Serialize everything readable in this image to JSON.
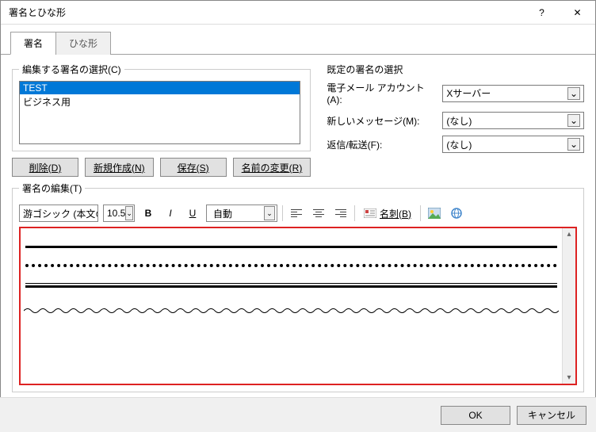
{
  "window": {
    "title": "署名とひな形",
    "help": "?",
    "close": "✕"
  },
  "tabs": {
    "signature": "署名",
    "template": "ひな形"
  },
  "left": {
    "legend": "編集する署名の選択(C)",
    "items": [
      "TEST",
      "ビジネス用"
    ],
    "selected_index": 0,
    "buttons": {
      "delete": "削除(D)",
      "new": "新規作成(N)",
      "save": "保存(S)",
      "rename": "名前の変更(R)"
    }
  },
  "right": {
    "legend": "既定の署名の選択",
    "account_label": "電子メール アカウント(A):",
    "account_value": "Xサーバー",
    "newmsg_label": "新しいメッセージ(M):",
    "newmsg_value": "(なし)",
    "reply_label": "返信/転送(F):",
    "reply_value": "(なし)"
  },
  "edit": {
    "legend": "署名の編集(T)",
    "font": "游ゴシック (本文の",
    "size": "10.5",
    "auto": "自動",
    "card": "名刺(B)"
  },
  "footer": {
    "ok": "OK",
    "cancel": "キャンセル"
  },
  "icons": {
    "chev": "⌄",
    "up": "▴",
    "down": "▾"
  }
}
